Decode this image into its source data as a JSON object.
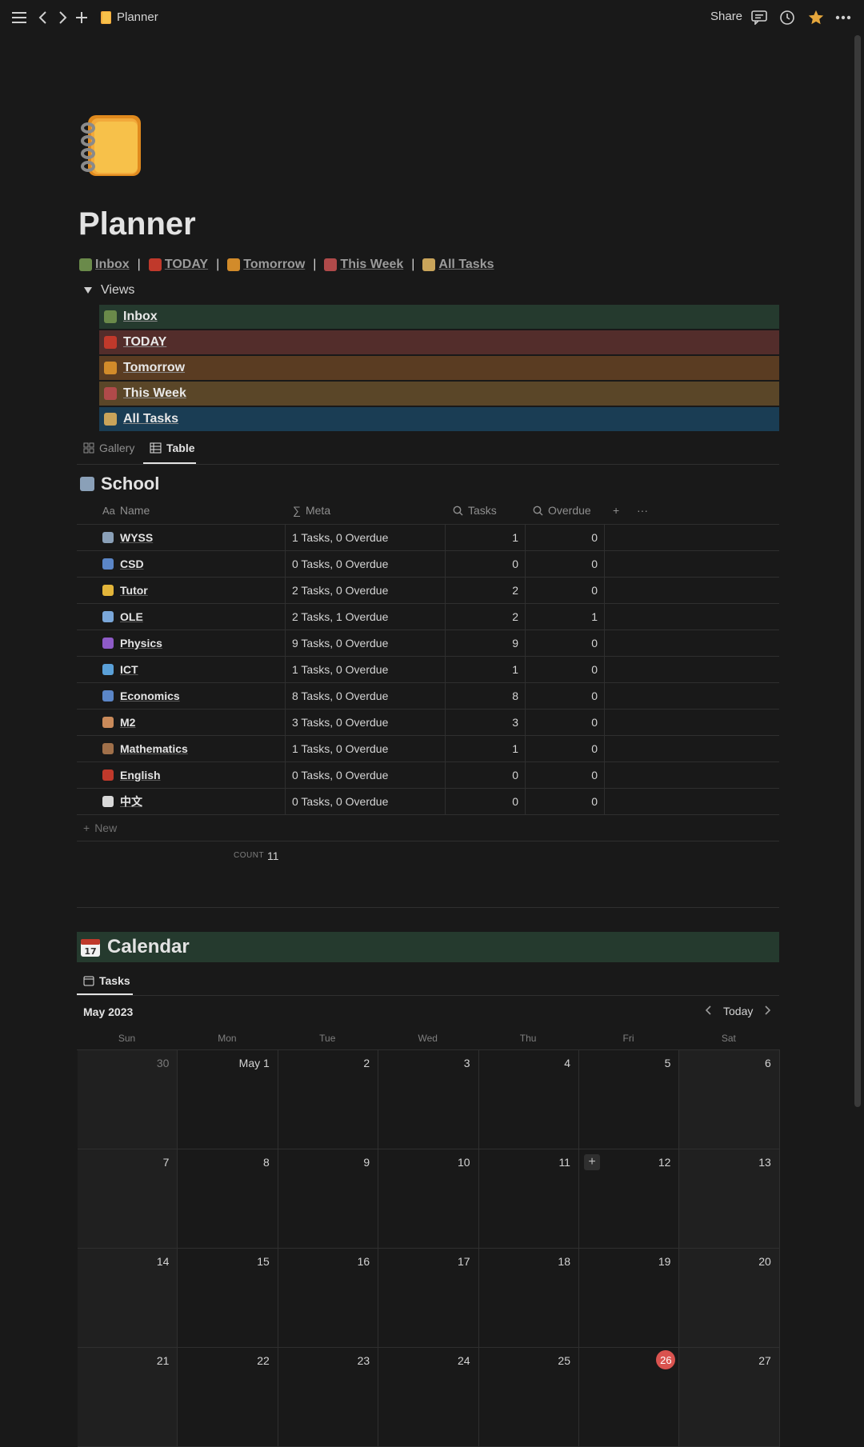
{
  "topbar": {
    "breadcrumb": "Planner",
    "share_label": "Share",
    "icons": [
      "menu-icon",
      "back-icon",
      "forward-icon",
      "add-icon",
      "comment-icon",
      "history-icon",
      "star-icon",
      "more-icon"
    ]
  },
  "page": {
    "title": "Planner",
    "icon": "notebook-icon"
  },
  "links": [
    {
      "label": "Inbox",
      "icon": "inbox-tray-icon",
      "color": "#6a8a4a"
    },
    {
      "label": "TODAY",
      "icon": "siren-icon",
      "color": "#c0392b"
    },
    {
      "label": "Tomorrow",
      "icon": "sunset-city-icon",
      "color": "#d28b2a"
    },
    {
      "label": "This Week",
      "icon": "calendar-icon",
      "color": "#b04a4a"
    },
    {
      "label": "All Tasks",
      "icon": "folder-icon",
      "color": "#c9a45a"
    }
  ],
  "views_toggle": {
    "label": "Views",
    "items": [
      {
        "label": "Inbox",
        "bg": "#253a2e",
        "icon": "inbox-tray-icon",
        "color": "#6a8a4a"
      },
      {
        "label": "TODAY",
        "bg": "#532d2b",
        "icon": "siren-icon",
        "color": "#c0392b"
      },
      {
        "label": "Tomorrow",
        "bg": "#5a3c22",
        "icon": "sunset-city-icon",
        "color": "#d28b2a"
      },
      {
        "label": "This Week",
        "bg": "#5a4628",
        "icon": "calendar-icon",
        "color": "#b04a4a"
      },
      {
        "label": "All Tasks",
        "bg": "#1a3d54",
        "icon": "folder-icon",
        "color": "#c9a45a"
      }
    ]
  },
  "view_tabs": [
    {
      "label": "Gallery",
      "icon": "gallery-icon",
      "active": false
    },
    {
      "label": "Table",
      "icon": "table-icon",
      "active": true
    }
  ],
  "school": {
    "title": "School",
    "columns": {
      "name": "Name",
      "meta": "Meta",
      "tasks": "Tasks",
      "overdue": "Overdue"
    },
    "rows": [
      {
        "name": "WYSS",
        "meta": "1 Tasks, 0 Overdue",
        "tasks": "1",
        "overdue": "0",
        "icon": "school-icon",
        "color": "#8aa0b8"
      },
      {
        "name": "CSD",
        "meta": "0 Tasks, 0 Overdue",
        "tasks": "0",
        "overdue": "0",
        "icon": "bar-chart-icon",
        "color": "#5b86c7"
      },
      {
        "name": "Tutor",
        "meta": "2 Tasks, 0 Overdue",
        "tasks": "2",
        "overdue": "0",
        "icon": "nerd-face-icon",
        "color": "#e3b53a"
      },
      {
        "name": "OLE",
        "meta": "2 Tasks, 1 Overdue",
        "tasks": "2",
        "overdue": "1",
        "icon": "open-book-icon",
        "color": "#7aa7d9"
      },
      {
        "name": "Physics",
        "meta": "9 Tasks, 0 Overdue",
        "tasks": "9",
        "overdue": "0",
        "icon": "atom-icon",
        "color": "#8e5bc7"
      },
      {
        "name": "ICT",
        "meta": "1 Tasks, 0 Overdue",
        "tasks": "1",
        "overdue": "0",
        "icon": "desktop-icon",
        "color": "#5aa0d8"
      },
      {
        "name": "Economics",
        "meta": "8 Tasks, 0 Overdue",
        "tasks": "8",
        "overdue": "0",
        "icon": "bar-chart-icon",
        "color": "#5b86c7"
      },
      {
        "name": "M2",
        "meta": "3 Tasks, 0 Overdue",
        "tasks": "3",
        "overdue": "0",
        "icon": "bandage-icon",
        "color": "#c98a5a"
      },
      {
        "name": "Mathematics",
        "meta": "1 Tasks, 0 Overdue",
        "tasks": "1",
        "overdue": "0",
        "icon": "abacus-icon",
        "color": "#a0704a"
      },
      {
        "name": "English",
        "meta": "0 Tasks, 0 Overdue",
        "tasks": "0",
        "overdue": "0",
        "icon": "uk-flag-icon",
        "color": "#c0392b"
      },
      {
        "name": "中文",
        "meta": "0 Tasks, 0 Overdue",
        "tasks": "0",
        "overdue": "0",
        "icon": "mahjong-icon",
        "color": "#d8d8d8"
      }
    ],
    "new_label": "New",
    "count_label": "COUNT",
    "count_value": "11"
  },
  "calendar": {
    "title": "Calendar",
    "tab_label": "Tasks",
    "month": "May 2023",
    "today_label": "Today",
    "weekdays": [
      "Sun",
      "Mon",
      "Tue",
      "Wed",
      "Thu",
      "Fri",
      "Sat"
    ],
    "weeks": [
      [
        "30",
        "May 1",
        "2",
        "3",
        "4",
        "5",
        "6"
      ],
      [
        "7",
        "8",
        "9",
        "10",
        "11",
        "12",
        "13"
      ],
      [
        "14",
        "15",
        "16",
        "17",
        "18",
        "19",
        "20"
      ],
      [
        "21",
        "22",
        "23",
        "24",
        "25",
        "26",
        "27"
      ]
    ],
    "today_day": "26",
    "muted_days": [
      "30"
    ]
  }
}
